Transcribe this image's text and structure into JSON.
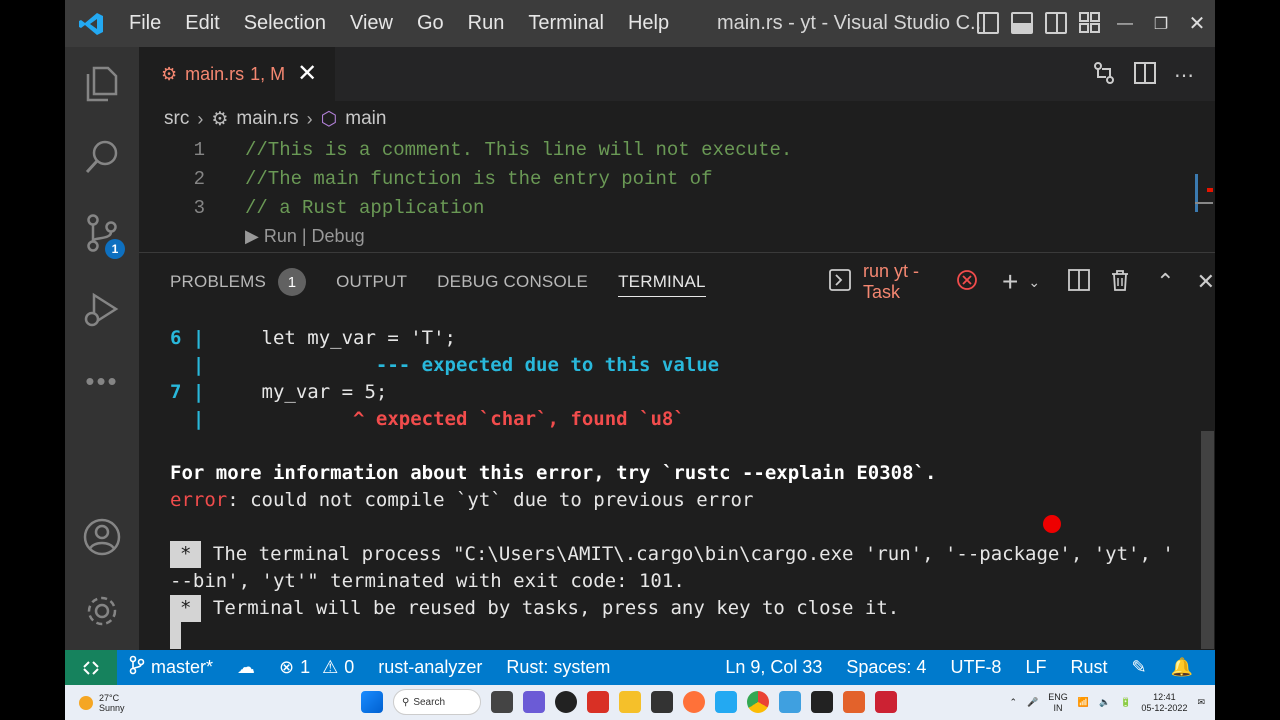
{
  "window": {
    "title": "main.rs - yt - Visual Studio C...",
    "menu": [
      "File",
      "Edit",
      "Selection",
      "View",
      "Go",
      "Run",
      "Terminal",
      "Help"
    ]
  },
  "activity_bar": {
    "icons": [
      "explorer-icon",
      "search-icon",
      "source-control-icon",
      "run-debug-icon",
      "more-icon",
      "account-icon",
      "settings-icon"
    ],
    "source_control_badge": "1"
  },
  "editor": {
    "tab": {
      "label": "main.rs",
      "status": "1, M"
    },
    "breadcrumb": [
      "src",
      "main.rs",
      "main"
    ],
    "lines": [
      {
        "num": "1",
        "text": "//This is a comment. This line will not execute."
      },
      {
        "num": "2",
        "text": "//The main function is the entry point of"
      },
      {
        "num": "3",
        "text": "// a Rust application"
      }
    ],
    "codelens": "▶ Run | Debug"
  },
  "panel": {
    "tabs": [
      "PROBLEMS",
      "OUTPUT",
      "DEBUG CONSOLE",
      "TERMINAL"
    ],
    "problems_count": "1",
    "active_tab": "TERMINAL",
    "task_label": "run yt - Task",
    "terminal": {
      "l1_num": "6",
      "l1_bar": " |",
      "l1_code": "     let my_var = 'T';",
      "l2_bar": "  |",
      "l2_note": "               --- expected due to this value",
      "l3_num": "7",
      "l3_bar": " |",
      "l3_code": "     my_var = 5;",
      "l4_bar": "  |",
      "l4_note": "             ^ expected `char`, found `u8`",
      "info": "For more information about this error, try `rustc --explain E0308`.",
      "error_word": "error",
      "error_msg": ": could not compile `yt` due to previous error",
      "star": "*",
      "process_line1": " The terminal process \"C:\\Users\\AMIT\\.cargo\\bin\\cargo.exe 'run', '--package', 'yt', '",
      "process_line2": "--bin', 'yt'\" terminated with exit code: 101.",
      "reuse_line": " Terminal will be reused by tasks, press any key to close it."
    }
  },
  "status_bar": {
    "branch": "master*",
    "errors": "1",
    "warnings": "0",
    "analyzer": "rust-analyzer",
    "rust_system": "Rust: system",
    "position": "Ln 9, Col 33",
    "spaces": "Spaces: 4",
    "encoding": "UTF-8",
    "eol": "LF",
    "language": "Rust"
  },
  "taskbar": {
    "temp": "27°C",
    "weather": "Sunny",
    "search": "Search",
    "lang_line1": "ENG",
    "lang_line2": "IN",
    "time": "12:41",
    "date": "05-12-2022"
  },
  "colors": {
    "accent": "#007acc",
    "remote": "#16825d",
    "error": "#f14c4c",
    "info": "#29b8db",
    "comment": "#6a9955",
    "modified": "#f48771"
  }
}
